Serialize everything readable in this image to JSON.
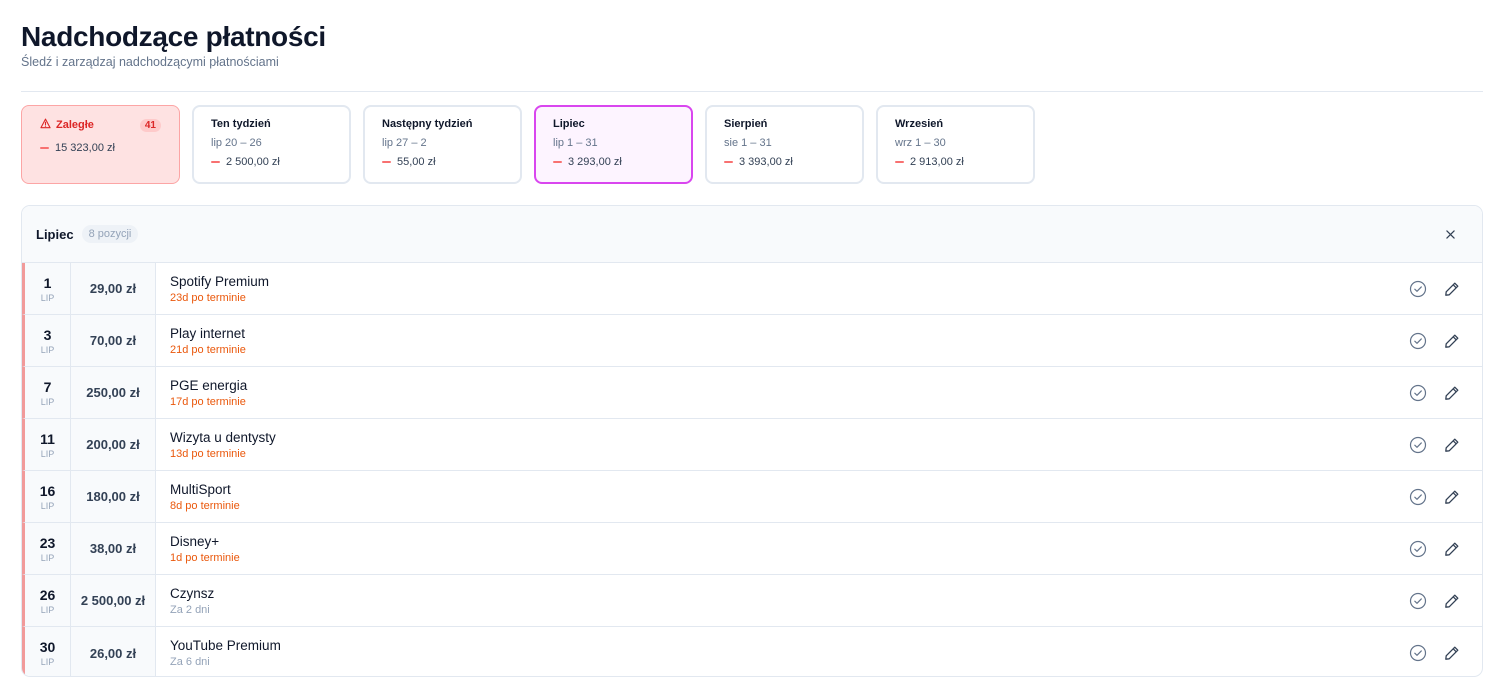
{
  "page": {
    "title": "Nadchodzące płatności",
    "subtitle": "Śledź i zarządzaj nadchodzącymi płatnościami"
  },
  "periods": [
    {
      "name": "Zaległe",
      "badge": "41",
      "amount": "15 323,00 zł",
      "type": "overdue"
    },
    {
      "name": "Ten tydzień",
      "range": "lip 20 – 26",
      "amount": "2 500,00 zł"
    },
    {
      "name": "Następny tydzień",
      "range": "lip 27 – 2",
      "amount": "55,00 zł"
    },
    {
      "name": "Lipiec",
      "range": "lip 1 – 31",
      "amount": "3 293,00 zł",
      "active": true
    },
    {
      "name": "Sierpień",
      "range": "sie 1 – 31",
      "amount": "3 393,00 zł"
    },
    {
      "name": "Wrzesień",
      "range": "wrz 1 – 30",
      "amount": "2 913,00 zł"
    }
  ],
  "panel": {
    "title": "Lipiec",
    "count": "8 pozycji",
    "close_icon": "close-icon"
  },
  "payments": [
    {
      "day": "1",
      "month": "LIP",
      "amount": "29,00 zł",
      "name": "Spotify Premium",
      "status": "23d po terminie",
      "overdue": true
    },
    {
      "day": "3",
      "month": "LIP",
      "amount": "70,00 zł",
      "name": "Play internet",
      "status": "21d po terminie",
      "overdue": true
    },
    {
      "day": "7",
      "month": "LIP",
      "amount": "250,00 zł",
      "name": "PGE energia",
      "status": "17d po terminie",
      "overdue": true
    },
    {
      "day": "11",
      "month": "LIP",
      "amount": "200,00 zł",
      "name": "Wizyta u dentysty",
      "status": "13d po terminie",
      "overdue": true
    },
    {
      "day": "16",
      "month": "LIP",
      "amount": "180,00 zł",
      "name": "MultiSport",
      "status": "8d po terminie",
      "overdue": true
    },
    {
      "day": "23",
      "month": "LIP",
      "amount": "38,00 zł",
      "name": "Disney+",
      "status": "1d po terminie",
      "overdue": true
    },
    {
      "day": "26",
      "month": "LIP",
      "amount": "2 500,00 zł",
      "name": "Czynsz",
      "status": "Za 2 dni",
      "overdue": false
    },
    {
      "day": "30",
      "month": "LIP",
      "amount": "26,00 zł",
      "name": "YouTube Premium",
      "status": "Za 6 dni",
      "overdue": false
    }
  ],
  "colors": {
    "accent": "#d946ef",
    "overdue": "#dc2626",
    "overdue_status": "#ea580c",
    "row_marker": "#f19a9a"
  },
  "icons": {
    "mark_paid": "check-circle-icon",
    "edit": "pencil-icon",
    "warning": "warning-triangle-icon"
  }
}
